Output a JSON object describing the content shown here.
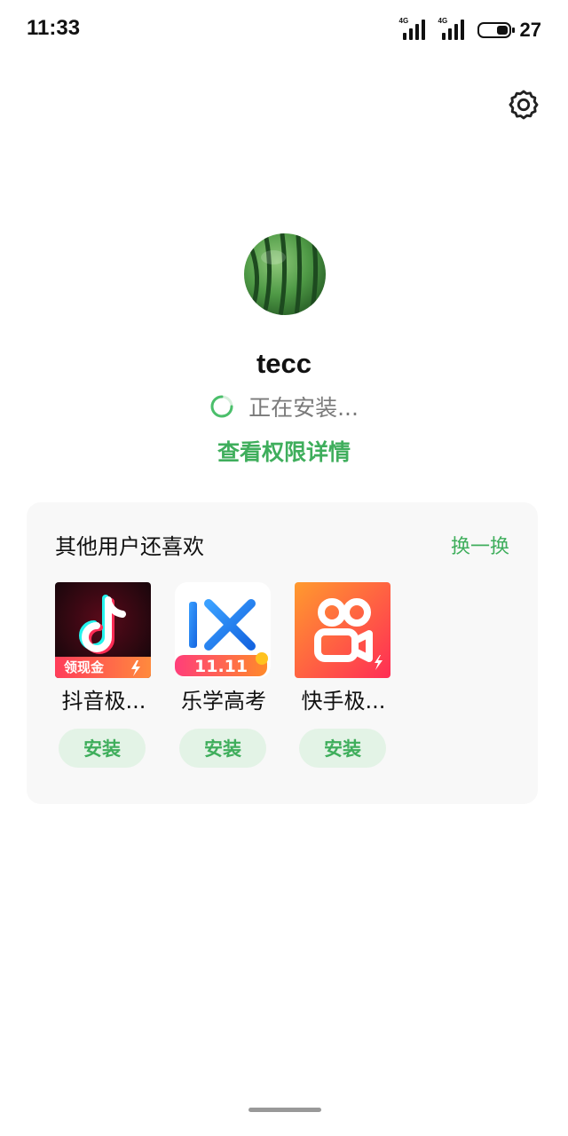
{
  "status_bar": {
    "time": "11:33",
    "network_1": "4G",
    "network_2": "4G",
    "battery": "27"
  },
  "header": {
    "settings_icon": "gear-icon"
  },
  "app": {
    "name": "tecc",
    "icon": "watermelon-icon",
    "status": "正在安装...",
    "permissions_link": "查看权限详情"
  },
  "recommendations": {
    "title": "其他用户还喜欢",
    "refresh": "换一换",
    "apps": [
      {
        "name": "抖音极...",
        "icon": "douyin-lite-icon",
        "badge": "领现金",
        "install": "安装"
      },
      {
        "name": "乐学高考",
        "icon": "lexue-gaokao-icon",
        "badge": "11.11",
        "install": "安装"
      },
      {
        "name": "快手极...",
        "icon": "kuaishou-lite-icon",
        "install": "安装"
      }
    ]
  },
  "colors": {
    "accent": "#3fae5c",
    "button_bg": "#e3f3e6",
    "card_bg": "#f8f8f8",
    "muted_text": "#7a7a7a"
  }
}
